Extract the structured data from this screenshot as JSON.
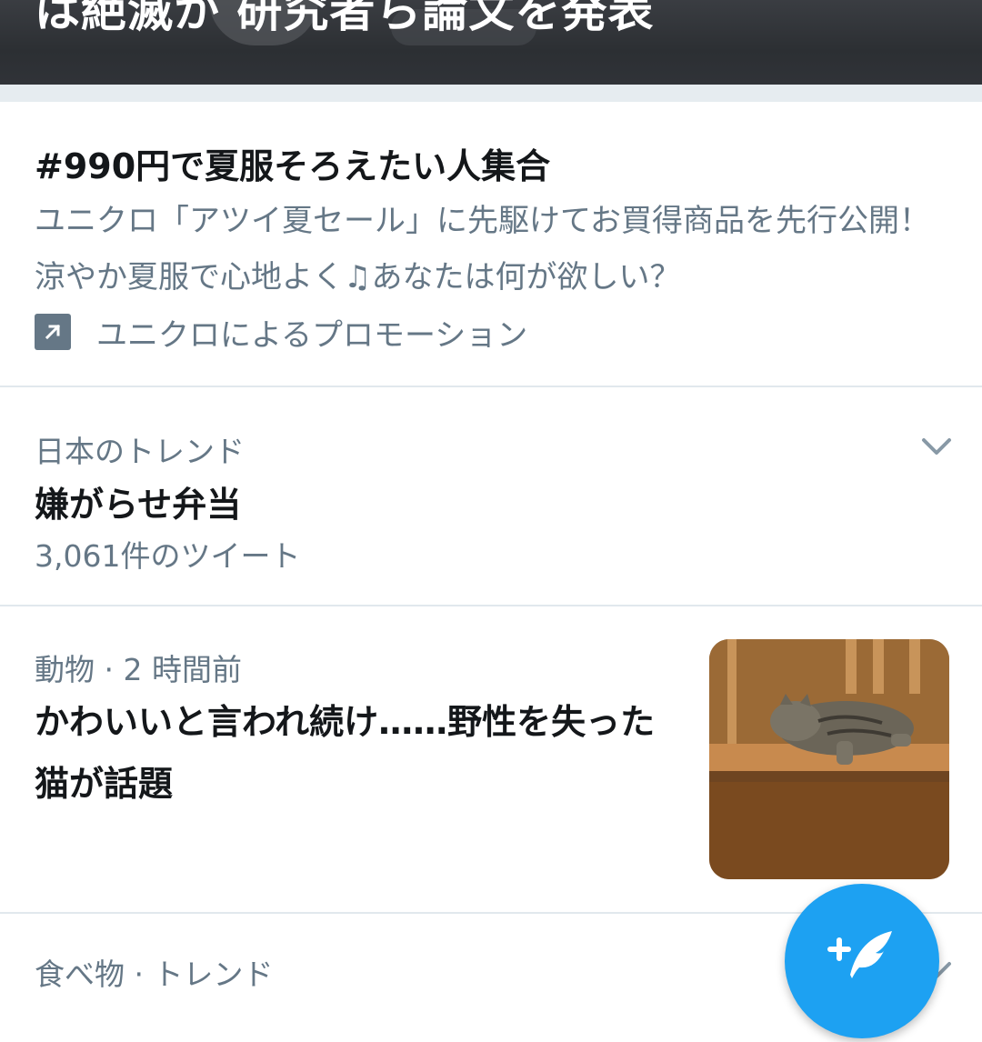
{
  "banner": {
    "headline": "は絶滅か 研究者ら論文を発表"
  },
  "promo": {
    "title": "#990円で夏服そろえたい人集合",
    "description": "ユニクロ「アツイ夏セール」に先駆けてお買得商品を先行公開！涼やか夏服で心地よく♫あなたは何が欲しい？",
    "promoted_by": "ユニクロによるプロモーション",
    "icon": "promoted-arrow-icon"
  },
  "trends": [
    {
      "context": "日本のトレンド",
      "title": "嫌がらせ弁当",
      "count": "3,061件のツイート",
      "icon": "chevron-down-icon"
    },
    {
      "context": "動物 · 2 時間前",
      "title": "かわいいと言われ続け……野性を失った猫が話題",
      "thumbnail": "sleeping-cat-photo"
    },
    {
      "context": "食べ物 · トレンド",
      "icon": "chevron-down-icon"
    }
  ],
  "fab": {
    "icon": "compose-tweet-icon",
    "color": "#1da1f2"
  }
}
